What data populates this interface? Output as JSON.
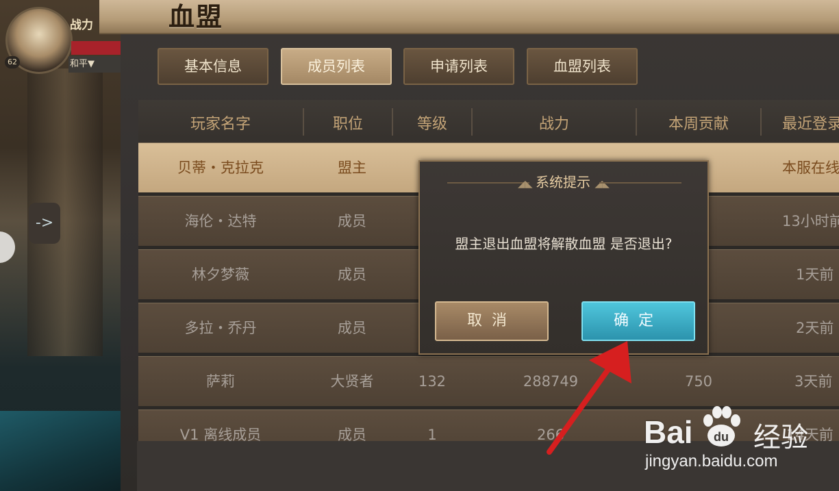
{
  "hud": {
    "avatar_level": "62",
    "power_label": "战力",
    "mode_label": "和平▼",
    "side_arrow": "->"
  },
  "window": {
    "title": "血盟"
  },
  "tabs": [
    {
      "label": "基本信息",
      "active": false
    },
    {
      "label": "成员列表",
      "active": true
    },
    {
      "label": "申请列表",
      "active": false
    },
    {
      "label": "血盟列表",
      "active": false
    }
  ],
  "table": {
    "headers": [
      "玩家名字",
      "职位",
      "等级",
      "战力",
      "本周贡献",
      "最近登录"
    ],
    "rows": [
      {
        "name": "贝蒂・克拉克",
        "role": "盟主",
        "level": "",
        "power": "",
        "contribution": "",
        "last_login": "本服在线",
        "highlight": true
      },
      {
        "name": "海伦・达特",
        "role": "成员",
        "level": "",
        "power": "",
        "contribution": "",
        "last_login": "13小时前",
        "highlight": false
      },
      {
        "name": "林夕梦薇",
        "role": "成员",
        "level": "",
        "power": "",
        "contribution": "",
        "last_login": "1天前",
        "highlight": false
      },
      {
        "name": "多拉・乔丹",
        "role": "成员",
        "level": "",
        "power": "",
        "contribution": "",
        "last_login": "2天前",
        "highlight": false
      },
      {
        "name": "萨莉",
        "role": "大贤者",
        "level": "132",
        "power": "288749",
        "contribution": "750",
        "last_login": "3天前",
        "highlight": false
      },
      {
        "name": "V1 离线成员",
        "role": "成员",
        "level": "1",
        "power": "266",
        "contribution": "",
        "last_login": "14天前",
        "highlight": false
      }
    ]
  },
  "dialog": {
    "title": "系统提示",
    "message": "盟主退出血盟将解散血盟 是否退出?",
    "cancel_label": "取消",
    "confirm_label": "确定"
  },
  "watermark": {
    "brand": "Bai",
    "brand_cn": "经验",
    "url": "jingyan.baidu.com"
  },
  "colors": {
    "accent_gold": "#c4a477",
    "confirm_blue": "#3fb3cc",
    "arrow_red": "#d61f1f"
  }
}
